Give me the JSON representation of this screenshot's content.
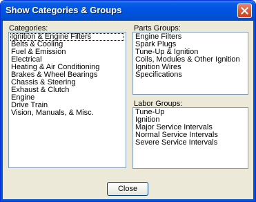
{
  "window": {
    "title": "Show Categories & Groups"
  },
  "categories": {
    "label": "Categories:",
    "items": [
      "Ignition & Engine Filters",
      "Belts & Cooling",
      "Fuel & Emission",
      "Electrical",
      "Heating & Air Conditioning",
      "Brakes & Wheel Bearings",
      "Chassis & Steering",
      "Exhaust & Clutch",
      "Engine",
      "Drive Train",
      "Vision, Manuals, & Misc."
    ]
  },
  "parts_groups": {
    "label": "Parts Groups:",
    "items": [
      "Engine Filters",
      "Spark Plugs",
      "Tune-Up & Ignition",
      "Coils, Modules & Other Ignition",
      "Ignition Wires",
      "Specifications"
    ]
  },
  "labor_groups": {
    "label": "Labor Groups:",
    "items": [
      "Tune-Up",
      "Ignition",
      "Major Service Intervals",
      "Normal Service Intervals",
      "Severe Service Intervals"
    ]
  },
  "buttons": {
    "close": "Close"
  },
  "icons": {
    "close": "close-x-icon"
  }
}
